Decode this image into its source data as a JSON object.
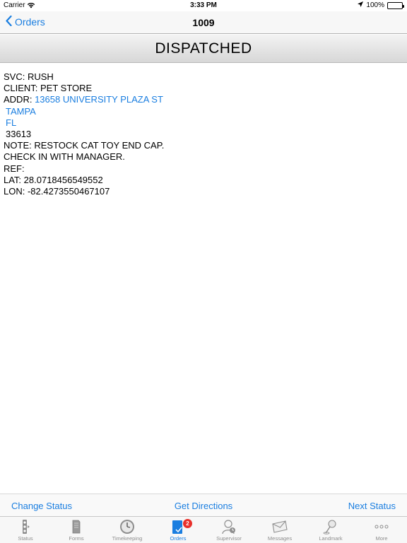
{
  "status_bar": {
    "carrier": "Carrier",
    "time": "3:33 PM",
    "battery": "100%"
  },
  "nav": {
    "back_label": "Orders",
    "title": "1009"
  },
  "order_status": "DISPATCHED",
  "details": {
    "svc": "SVC: RUSH",
    "client": "CLIENT: PET STORE",
    "addr_prefix": "ADDR: ",
    "street": "13658 UNIVERSITY PLAZA ST",
    "city": "TAMPA",
    "state": "FL",
    "zip": "33613",
    "note": "NOTE: RESTOCK CAT TOY END CAP.",
    "note_cont": "CHECK IN WITH MANAGER.",
    "ref": "REF:",
    "lat": "LAT: 28.0718456549552",
    "lon": "LON: -82.4273550467107"
  },
  "actions": {
    "change_status": "Change Status",
    "get_directions": "Get Directions",
    "next_status": "Next Status"
  },
  "tabs": [
    {
      "label": "Status",
      "icon": "traffic-light-icon"
    },
    {
      "label": "Forms",
      "icon": "forms-icon"
    },
    {
      "label": "Timekeeping",
      "icon": "clock-icon"
    },
    {
      "label": "Orders",
      "icon": "orders-icon",
      "badge": "2",
      "active": true
    },
    {
      "label": "Supervisor",
      "icon": "supervisor-icon"
    },
    {
      "label": "Messages",
      "icon": "envelope-icon"
    },
    {
      "label": "Landmark",
      "icon": "pushpin-icon"
    },
    {
      "label": "More",
      "icon": "more-icon"
    }
  ],
  "colors": {
    "accent": "#1a7ee0",
    "badge": "#e8302b",
    "inactive_tab": "#8e8e8e"
  }
}
